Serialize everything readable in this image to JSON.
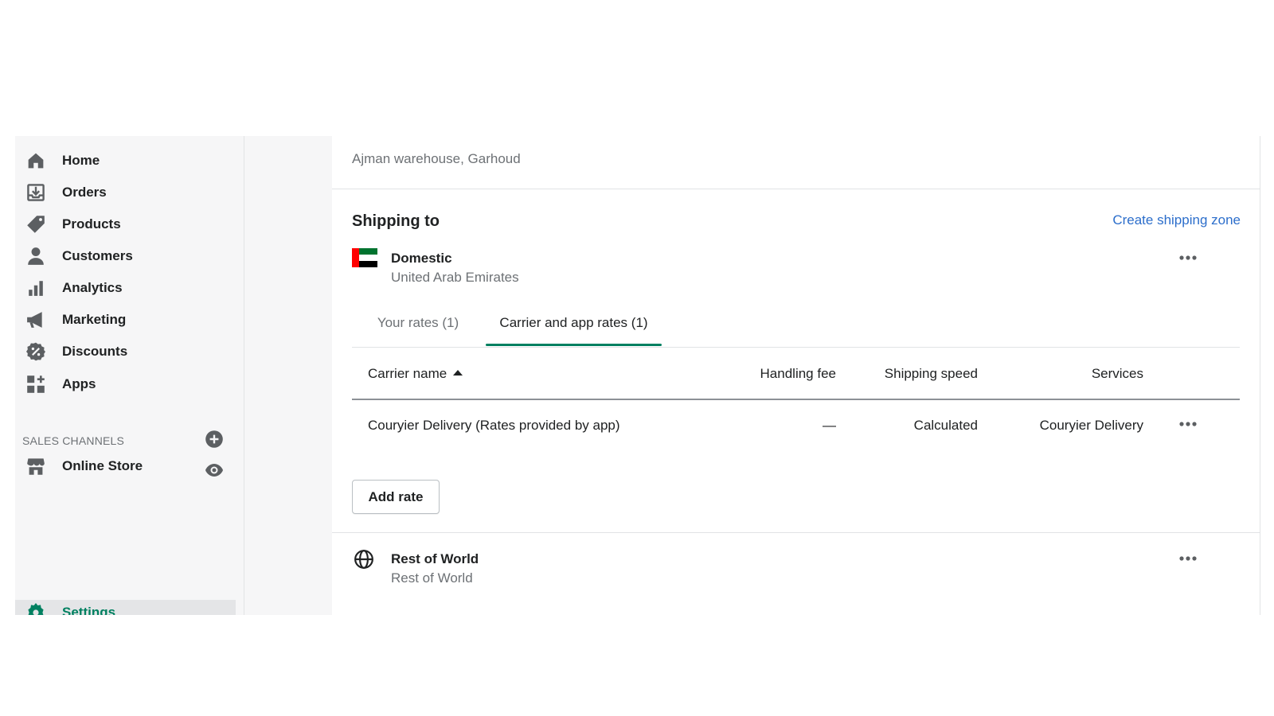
{
  "sidebar": {
    "items": [
      {
        "label": "Home",
        "icon": "home-icon"
      },
      {
        "label": "Orders",
        "icon": "orders-icon"
      },
      {
        "label": "Products",
        "icon": "tag-icon"
      },
      {
        "label": "Customers",
        "icon": "person-icon"
      },
      {
        "label": "Analytics",
        "icon": "bar-chart-icon"
      },
      {
        "label": "Marketing",
        "icon": "megaphone-icon"
      },
      {
        "label": "Discounts",
        "icon": "discount-icon"
      },
      {
        "label": "Apps",
        "icon": "apps-icon"
      }
    ],
    "sales_channels_label": "SALES CHANNELS",
    "online_store_label": "Online Store",
    "settings_label": "Settings"
  },
  "main": {
    "origin_text": "Ajman warehouse, Garhoud",
    "shipping_to_title": "Shipping to",
    "create_zone_link": "Create shipping zone",
    "zones": [
      {
        "name": "Domestic",
        "sub": "United Arab Emirates",
        "icon": "uae-flag-icon"
      },
      {
        "name": "Rest of World",
        "sub": "Rest of World",
        "icon": "globe-icon"
      }
    ],
    "tabs": [
      {
        "label": "Your rates (1)",
        "selected": false
      },
      {
        "label": "Carrier and app rates (1)",
        "selected": true
      }
    ],
    "table": {
      "headers": {
        "carrier": "Carrier name",
        "handling": "Handling fee",
        "speed": "Shipping speed",
        "services": "Services"
      },
      "rows": [
        {
          "carrier": "Couryier Delivery (Rates provided by app)",
          "handling": "—",
          "speed": "Calculated",
          "services": "Couryier Delivery"
        }
      ]
    },
    "add_rate_label": "Add rate"
  },
  "colors": {
    "accent": "#008060",
    "link": "#2c6ecb",
    "text": "#202223",
    "subdued": "#6d7175"
  }
}
